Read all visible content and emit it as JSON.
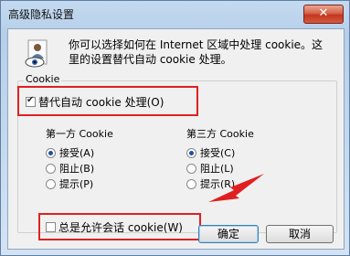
{
  "window": {
    "title": "高级隐私设置",
    "close_label": "✕"
  },
  "description": "你可以选择如何在 Internet 区域中处理 cookie。这里的设置替代自动 cookie 处理。",
  "group": {
    "label": "Cookie",
    "override_label": "替代自动 cookie 处理(O)",
    "override_checked": true,
    "first_party": {
      "heading": "第一方 Cookie",
      "options": [
        "接受(A)",
        "阻止(B)",
        "提示(P)"
      ],
      "selected": "接受(A)"
    },
    "third_party": {
      "heading": "第三方 Cookie",
      "options": [
        "接受(C)",
        "阻止(L)",
        "提示(R)"
      ],
      "selected": "接受(C)"
    },
    "session_label": "总是允许会话 cookie(W)",
    "session_checked": false
  },
  "buttons": {
    "ok": "确定",
    "cancel": "取消"
  },
  "colors": {
    "highlight": "#e02020"
  }
}
